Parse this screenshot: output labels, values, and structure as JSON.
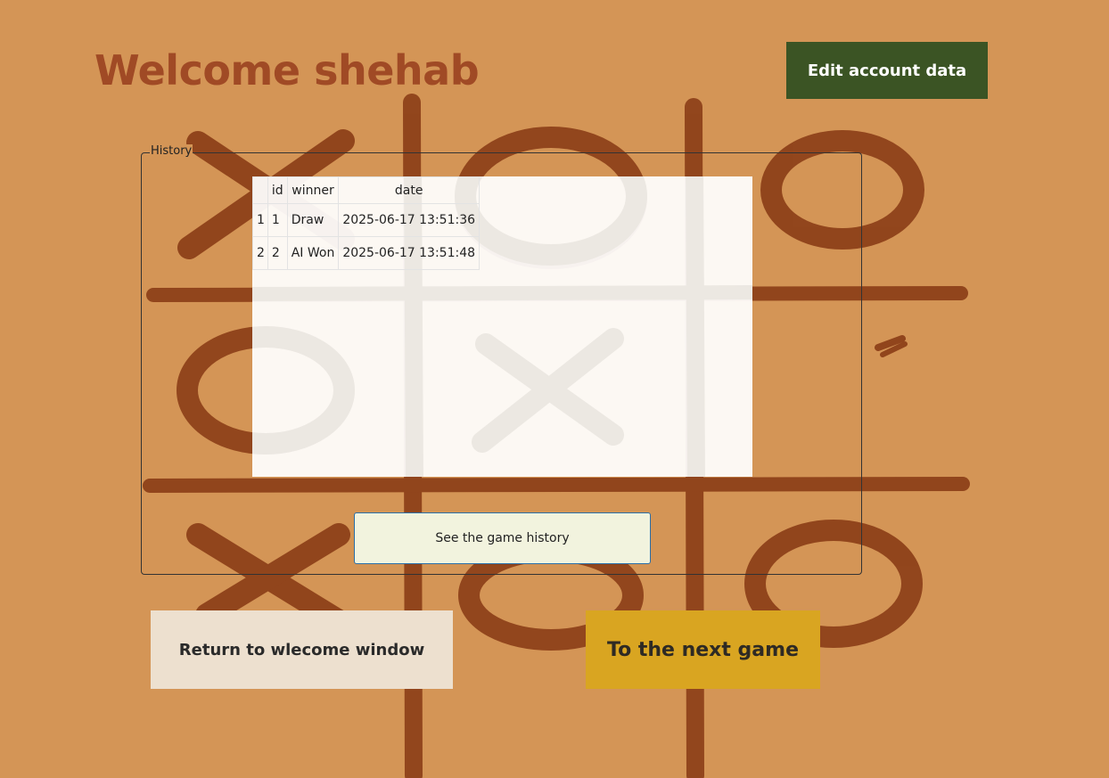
{
  "window": {
    "title": "Welcome shehab"
  },
  "header": {
    "edit_account_label": "Edit account data"
  },
  "history": {
    "legend": "History",
    "columns": [
      "",
      "id",
      "winner",
      "date"
    ],
    "rows": [
      {
        "row_num": "1",
        "id": "1",
        "winner": "Draw",
        "date": "2025-06-17 13:51:36"
      },
      {
        "row_num": "2",
        "id": "2",
        "winner": "AI Won",
        "date": "2025-06-17 13:51:48"
      }
    ],
    "see_history_label": "See the game history"
  },
  "footer": {
    "return_label": "Return to wlecome window",
    "next_game_label": "To the next game"
  },
  "colors": {
    "background": "#d49556",
    "title": "#a04a25",
    "brush": "#8c3f18",
    "edit_button": "#3b5424",
    "next_button": "#d9a521",
    "return_button": "#ede0cf",
    "see_history_button": "#f2f3de"
  },
  "icons": {
    "background": "tic-tac-toe-board-art"
  }
}
